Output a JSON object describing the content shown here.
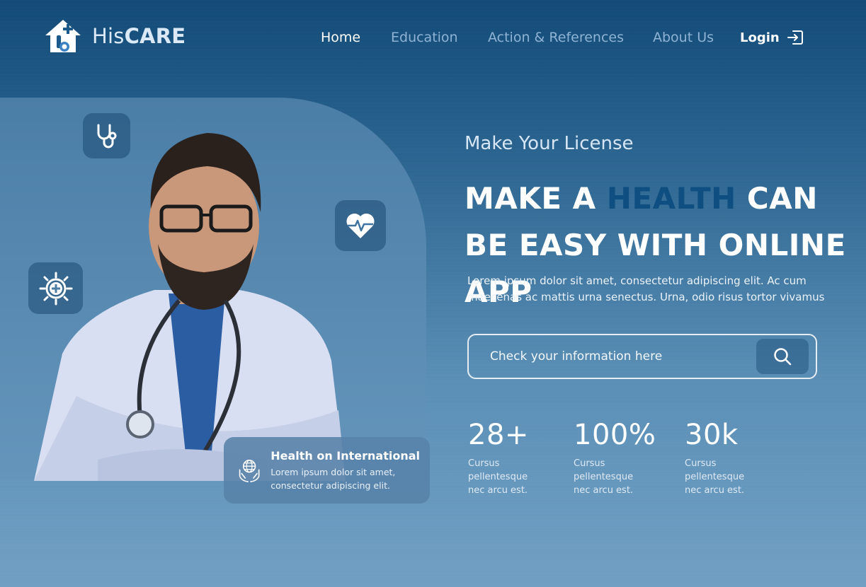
{
  "brand": {
    "name_regular": "His",
    "name_bold": "CARE"
  },
  "nav": {
    "items": [
      {
        "label": "Home",
        "active": true
      },
      {
        "label": "Education",
        "active": false
      },
      {
        "label": "Action & References",
        "active": false
      },
      {
        "label": "About Us",
        "active": false
      }
    ],
    "login_label": "Login"
  },
  "hero": {
    "eyebrow": "Make Your License",
    "headline_part1": "MAKE A ",
    "headline_highlight": "HEALTH",
    "headline_part2": " CAN BE EASY WITH ONLINE APP",
    "lead": "Lorem ipsum dolor sit amet, consectetur adipiscing elit. Ac cum maecenas ac mattis urna senectus. Urna, odio risus tortor vivamus",
    "search_placeholder": "Check your information here"
  },
  "info_card": {
    "title": "Health on International",
    "description": "Lorem ipsum dolor sit amet, consectetur adipiscing elit."
  },
  "stats": [
    {
      "value": "28+",
      "description": "Cursus pellentesque nec arcu est."
    },
    {
      "value": "100%",
      "description": "Cursus pellentesque nec arcu est."
    },
    {
      "value": "30k",
      "description": "Cursus pellentesque nec arcu est."
    }
  ],
  "icons": [
    "logo-house-icon",
    "stethoscope-icon",
    "heartbeat-icon",
    "virus-plus-icon",
    "globe-hands-icon",
    "search-icon",
    "login-arrow-icon"
  ],
  "colors": {
    "highlight": "#0f4e80",
    "bg_top": "#124a78",
    "bg_bottom": "#719fc3"
  }
}
